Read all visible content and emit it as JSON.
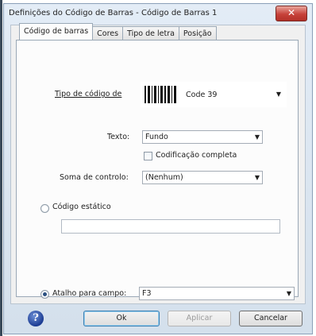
{
  "window": {
    "title": "Definições do Código de Barras - Código de Barras 1",
    "close_glyph": "✕"
  },
  "tabs": [
    {
      "label": "Código de barras",
      "active": true
    },
    {
      "label": "Cores",
      "active": false
    },
    {
      "label": "Tipo de letra",
      "active": false
    },
    {
      "label": "Posição",
      "active": false
    }
  ],
  "barcode_type": {
    "label": "Tipo de código de",
    "value": "Code 39",
    "icon": "barcode-icon"
  },
  "text": {
    "label": "Texto:",
    "value": "Fundo"
  },
  "full_encoding": {
    "label": "Codificação completa",
    "checked": false
  },
  "checksum": {
    "label": "Soma de controlo:",
    "value": "(Nenhum)"
  },
  "static_code": {
    "label": "Código estático",
    "selected": false,
    "value": ""
  },
  "field_shortcut": {
    "label": "Atalho para campo:",
    "selected": true,
    "value": "F3"
  },
  "buttons": {
    "help_glyph": "?",
    "ok": "Ok",
    "apply": "Aplicar",
    "cancel": "Cancelar"
  },
  "dropdown_glyph": "▼"
}
